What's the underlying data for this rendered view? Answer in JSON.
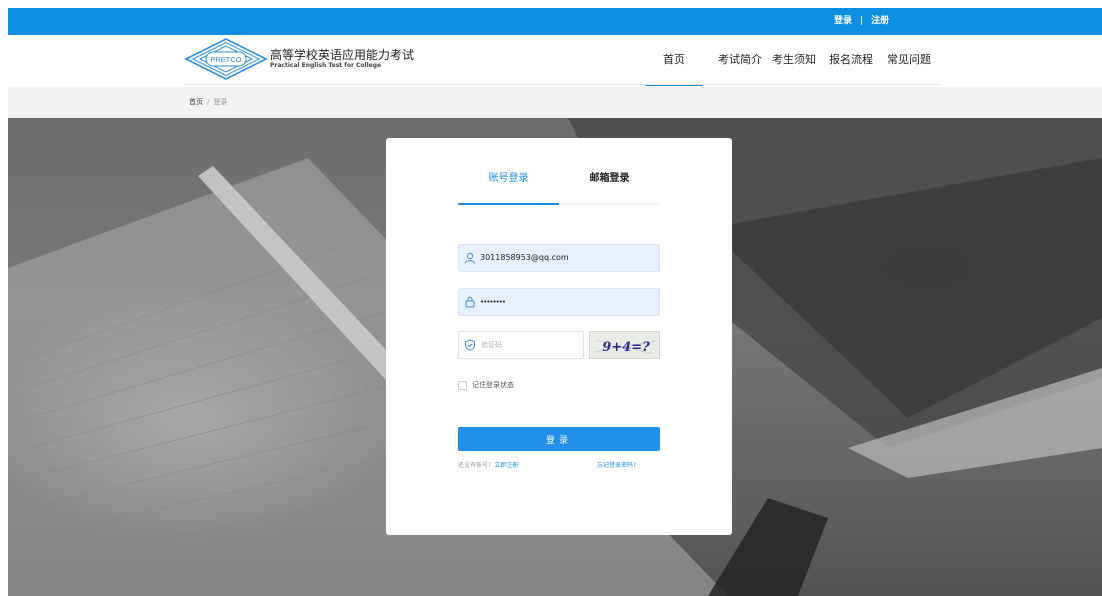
{
  "topbar": {
    "login": "登录",
    "separator": "|",
    "register": "注册",
    "color": "#0e8ee3"
  },
  "header": {
    "logo_badge": "PRETCO",
    "title_cn": "高等学校英语应用能力考试",
    "title_en": "Practical English Test for College",
    "nav": [
      {
        "label": "首页",
        "active": true
      },
      {
        "label": "考试简介",
        "active": false
      },
      {
        "label": "考生须知",
        "active": false
      },
      {
        "label": "报名流程",
        "active": false
      },
      {
        "label": "常见问题",
        "active": false
      }
    ]
  },
  "breadcrumb": {
    "home": "首页",
    "separator": "/",
    "current": "登录"
  },
  "login": {
    "tabs": [
      {
        "label": "账号登录",
        "active": true
      },
      {
        "label": "邮箱登录",
        "active": false
      }
    ],
    "account_value": "3011858953@qq.com",
    "password_value": "••••••••",
    "captcha_placeholder": "验证码",
    "captcha_text": "9+4=?",
    "remember_label": "记住登录状态",
    "submit_label": "登录",
    "no_account_text": "还没有账号?",
    "register_link": "立即注册",
    "forgot_link": "忘记登录密码?",
    "accent_color": "#1a8fe0"
  }
}
